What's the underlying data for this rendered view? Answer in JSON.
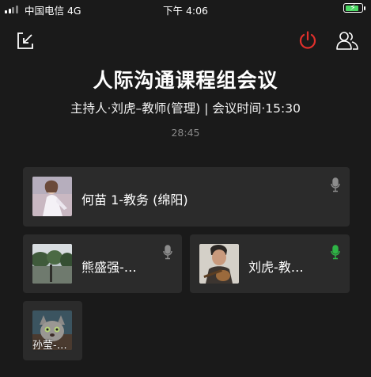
{
  "status_bar": {
    "carrier": "中国电信 4G",
    "time": "下午 4:06",
    "battery_level": 0.7
  },
  "meeting": {
    "title": "人际沟通课程组会议",
    "subtitle": "主持人·刘虎–教师(管理) | 会议时间·15:30",
    "duration": "28:45"
  },
  "participants": [
    {
      "name": "何苗 1-教务 (绵阳)",
      "mic_state": "muted",
      "avatar_icon": "avatar-woman-white-dress"
    },
    {
      "name": "熊盛强-…",
      "mic_state": "muted",
      "avatar_icon": "avatar-trees-landscape"
    },
    {
      "name": "刘虎-教…",
      "mic_state": "speaking",
      "avatar_icon": "avatar-man-guitar"
    },
    {
      "name": "孙莹-…",
      "mic_state": "muted",
      "avatar_icon": "avatar-cartoon-fox"
    }
  ],
  "colors": {
    "background": "#1a1a1a",
    "tile": "#2b2b2b",
    "power_red": "#e0302c",
    "mic_muted": "#8c8c8c",
    "mic_active": "#2fb446",
    "battery_green": "#4cd964"
  }
}
